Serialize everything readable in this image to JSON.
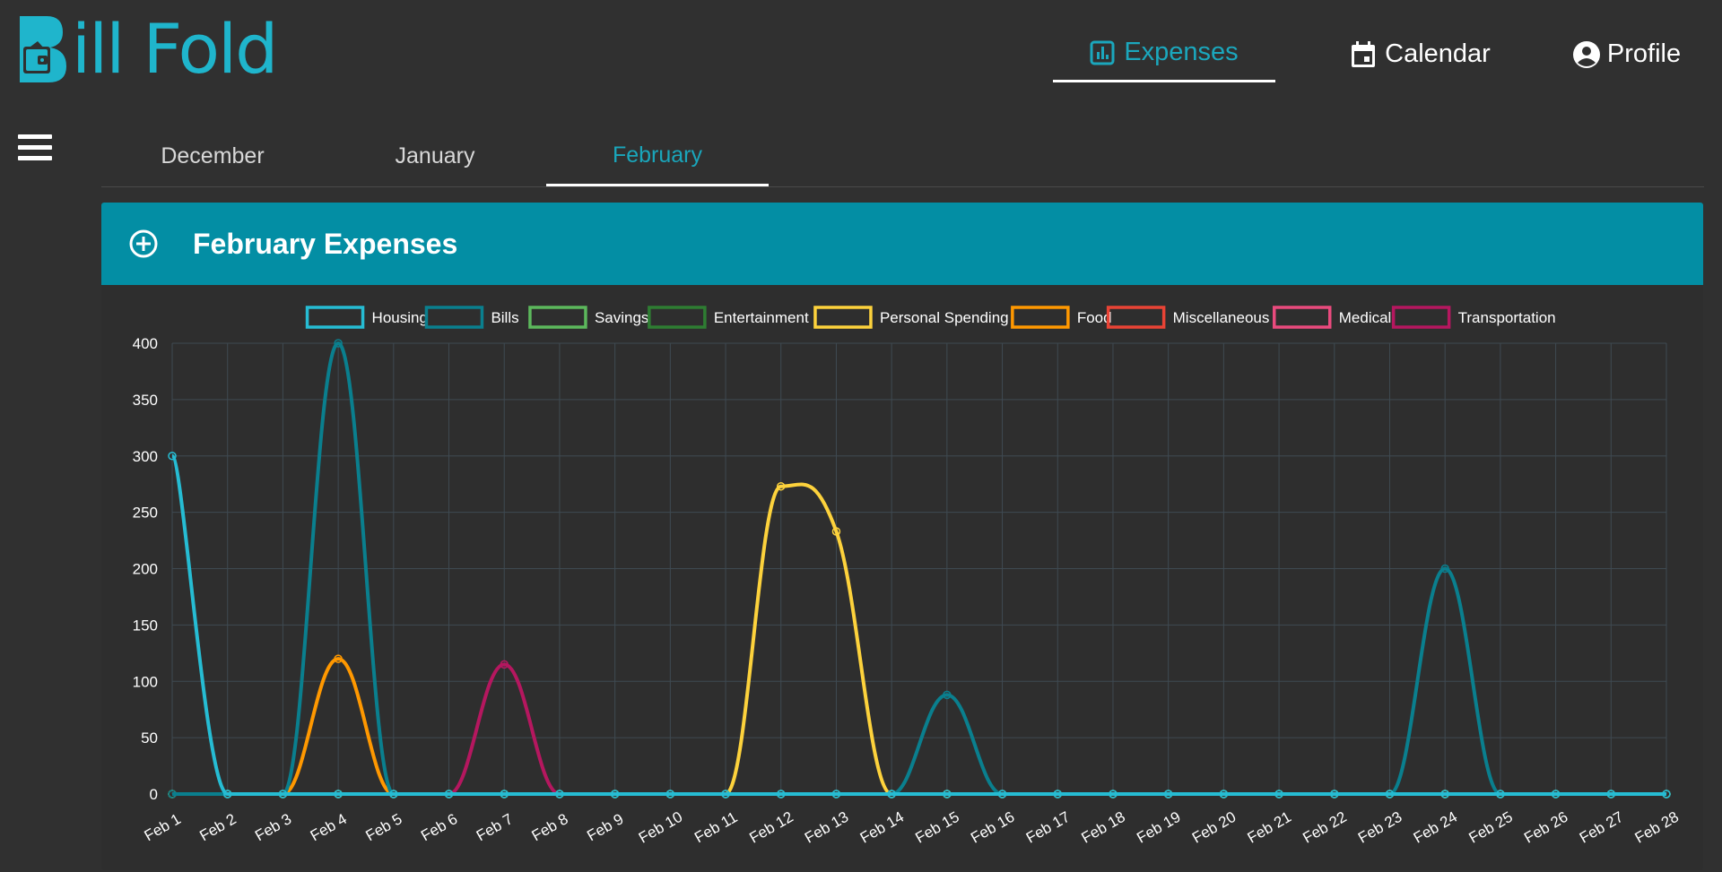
{
  "app": {
    "name": "Bill Fold",
    "logo_text": "ill Fold"
  },
  "nav": {
    "items": [
      {
        "label": "Expenses",
        "icon": "bar-chart-icon",
        "active": true
      },
      {
        "label": "Calendar",
        "icon": "calendar-icon",
        "active": false
      },
      {
        "label": "Profile",
        "icon": "account-circle-icon",
        "active": false
      }
    ]
  },
  "months": {
    "tabs": [
      {
        "label": "December",
        "active": false
      },
      {
        "label": "January",
        "active": false
      },
      {
        "label": "February",
        "active": true
      }
    ]
  },
  "card": {
    "title": "February Expenses",
    "add_icon": "add-circle-icon"
  },
  "colors": {
    "accent": "#038ea4",
    "active_text": "#1ba7bd",
    "background": "#303030"
  },
  "chart_data": {
    "type": "line",
    "title": "",
    "xlabel": "",
    "ylabel": "",
    "ylim": [
      0,
      400
    ],
    "yticks": [
      0,
      50,
      100,
      150,
      200,
      250,
      300,
      350,
      400
    ],
    "grid": true,
    "legend_position": "top",
    "categories": [
      "Feb 1",
      "Feb 2",
      "Feb 3",
      "Feb 4",
      "Feb 5",
      "Feb 6",
      "Feb 7",
      "Feb 8",
      "Feb 9",
      "Feb 10",
      "Feb 11",
      "Feb 12",
      "Feb 13",
      "Feb 14",
      "Feb 15",
      "Feb 16",
      "Feb 17",
      "Feb 18",
      "Feb 19",
      "Feb 20",
      "Feb 21",
      "Feb 22",
      "Feb 23",
      "Feb 24",
      "Feb 25",
      "Feb 26",
      "Feb 27",
      "Feb 28"
    ],
    "series": [
      {
        "name": "Housing",
        "color": "#26bcd3",
        "values": [
          300,
          0,
          0,
          0,
          0,
          0,
          0,
          0,
          0,
          0,
          0,
          0,
          0,
          0,
          0,
          0,
          0,
          0,
          0,
          0,
          0,
          0,
          0,
          0,
          0,
          0,
          0,
          0
        ]
      },
      {
        "name": "Bills",
        "color": "#0a7f8e",
        "values": [
          0,
          0,
          0,
          400,
          0,
          0,
          0,
          0,
          0,
          0,
          0,
          0,
          0,
          0,
          88,
          0,
          0,
          0,
          0,
          0,
          0,
          0,
          0,
          200,
          0,
          0,
          0,
          0
        ]
      },
      {
        "name": "Savings",
        "color": "#5cb85c",
        "values": [
          0,
          0,
          0,
          0,
          0,
          0,
          0,
          0,
          0,
          0,
          0,
          0,
          0,
          0,
          0,
          0,
          0,
          0,
          0,
          0,
          0,
          0,
          0,
          0,
          0,
          0,
          0,
          0
        ]
      },
      {
        "name": "Entertainment",
        "color": "#2e7d32",
        "values": [
          0,
          0,
          0,
          0,
          0,
          0,
          0,
          0,
          0,
          0,
          0,
          0,
          0,
          0,
          0,
          0,
          0,
          0,
          0,
          0,
          0,
          0,
          0,
          0,
          0,
          0,
          0,
          0
        ]
      },
      {
        "name": "Personal Spending",
        "color": "#fdd23c",
        "values": [
          0,
          0,
          0,
          0,
          0,
          0,
          0,
          0,
          0,
          0,
          0,
          273,
          233,
          0,
          0,
          0,
          0,
          0,
          0,
          0,
          0,
          0,
          0,
          0,
          0,
          0,
          0,
          0
        ]
      },
      {
        "name": "Food",
        "color": "#ff9800",
        "values": [
          0,
          0,
          0,
          120,
          0,
          0,
          0,
          0,
          0,
          0,
          0,
          0,
          0,
          0,
          0,
          0,
          0,
          0,
          0,
          0,
          0,
          0,
          0,
          0,
          0,
          0,
          0,
          0
        ]
      },
      {
        "name": "Miscellaneous",
        "color": "#e94335",
        "values": [
          0,
          0,
          0,
          0,
          0,
          0,
          0,
          0,
          0,
          0,
          0,
          0,
          0,
          0,
          0,
          0,
          0,
          0,
          0,
          0,
          0,
          0,
          0,
          0,
          0,
          0,
          0,
          0
        ]
      },
      {
        "name": "Medical",
        "color": "#e94a7d",
        "values": [
          0,
          0,
          0,
          0,
          0,
          0,
          0,
          0,
          0,
          0,
          0,
          0,
          0,
          0,
          0,
          0,
          0,
          0,
          0,
          0,
          0,
          0,
          0,
          0,
          0,
          0,
          0,
          0
        ]
      },
      {
        "name": "Transportation",
        "color": "#b5175f",
        "values": [
          0,
          0,
          0,
          0,
          0,
          0,
          115,
          0,
          0,
          0,
          0,
          0,
          0,
          0,
          0,
          0,
          0,
          0,
          0,
          0,
          0,
          0,
          0,
          0,
          0,
          0,
          0,
          0
        ]
      }
    ]
  }
}
